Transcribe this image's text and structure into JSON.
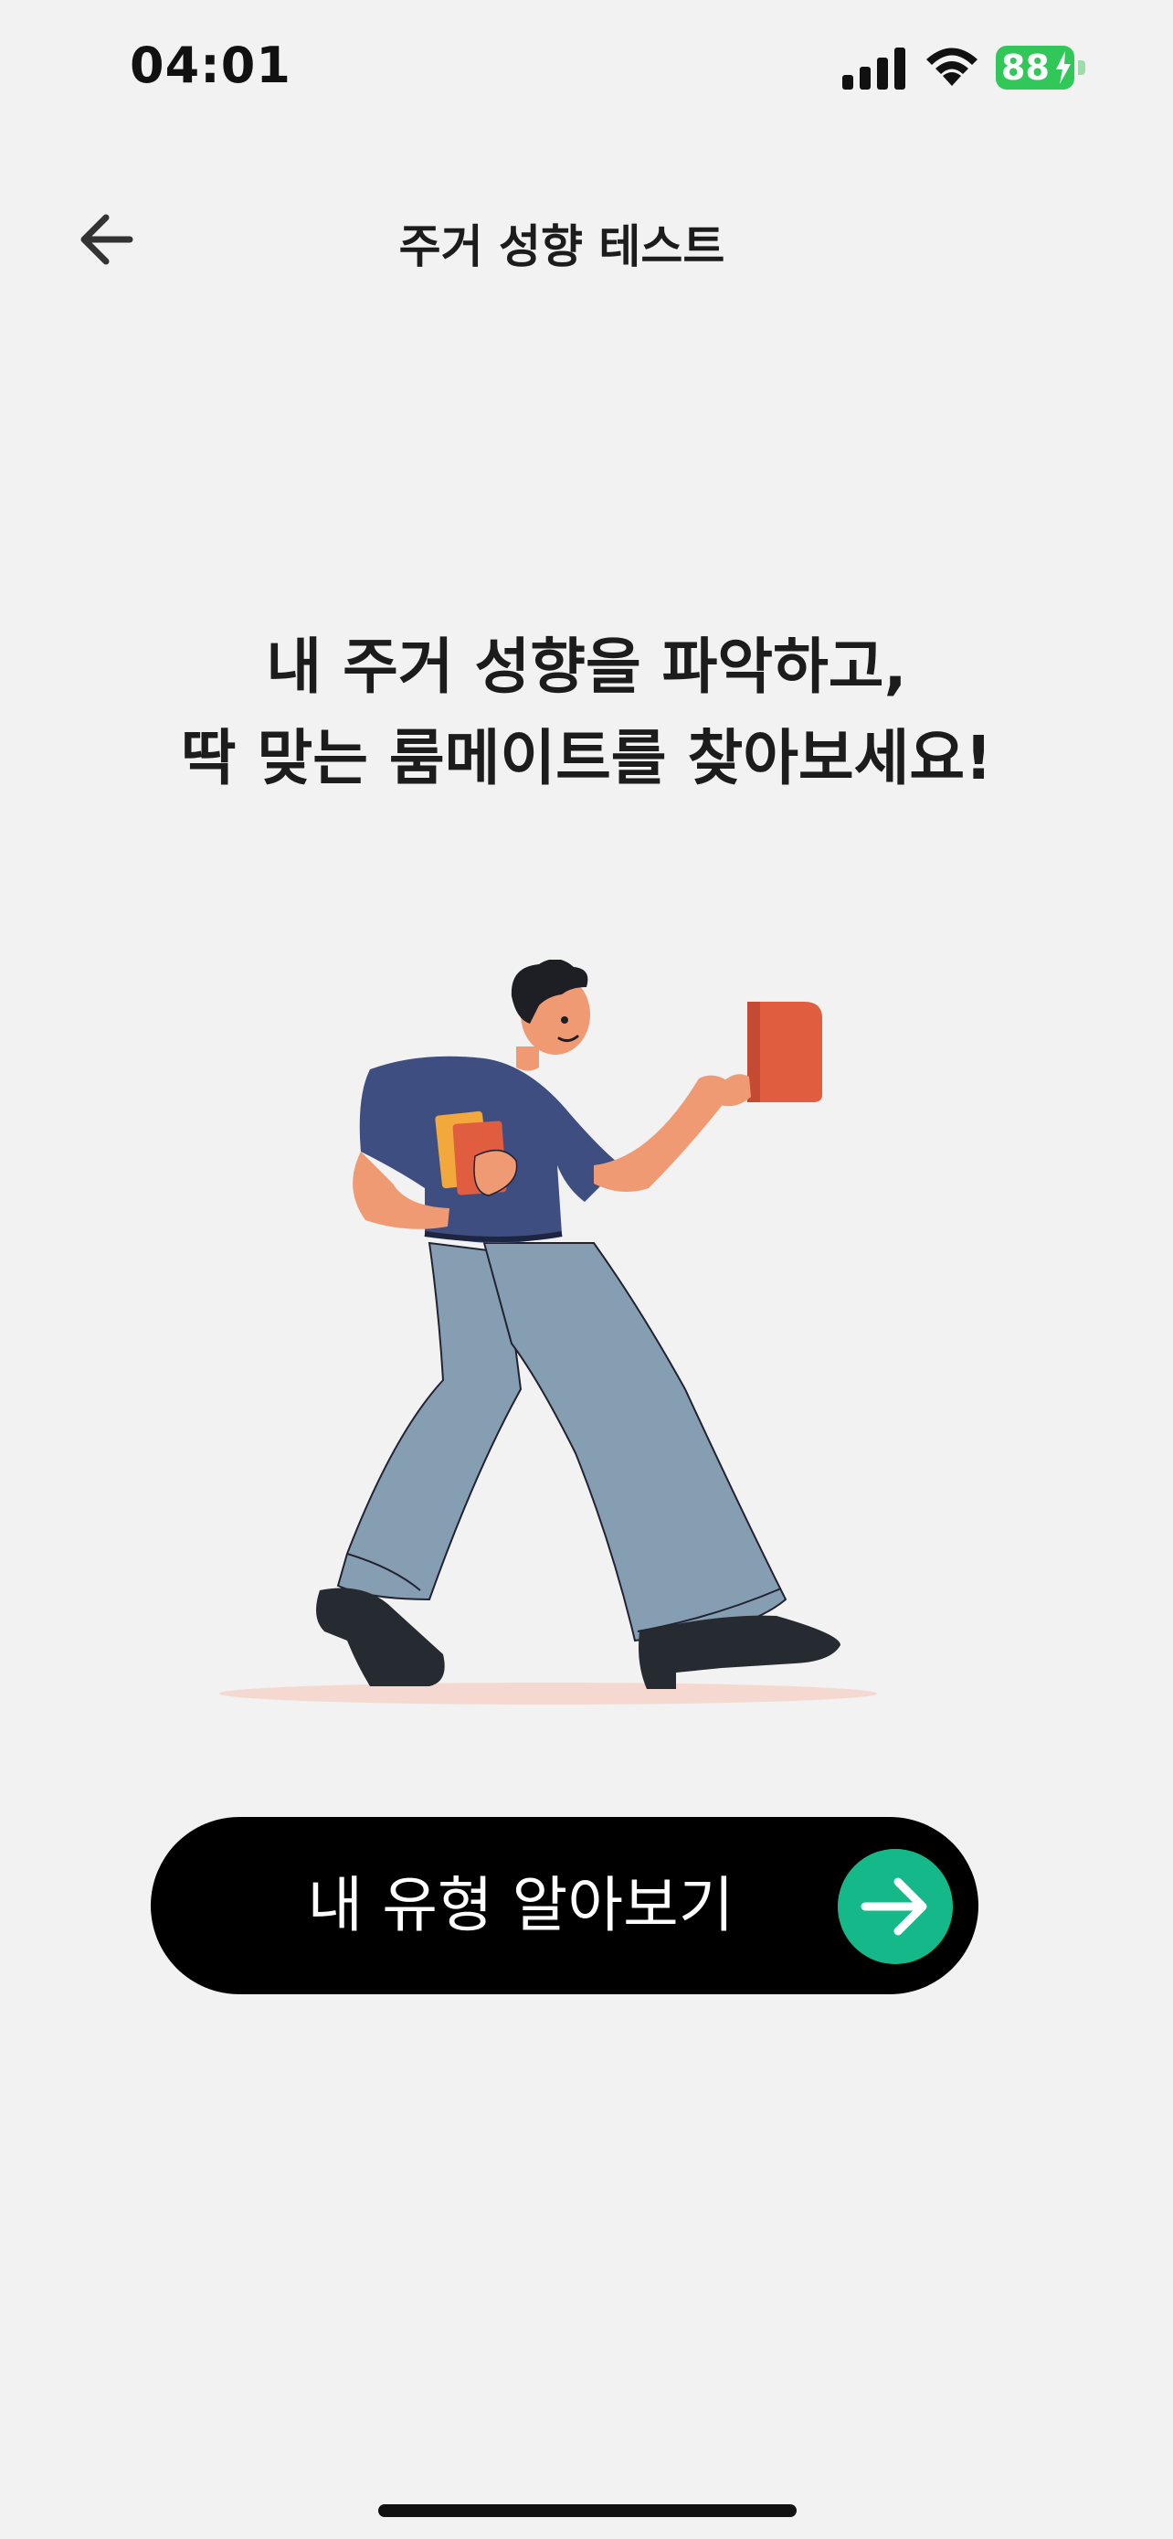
{
  "status_bar": {
    "time": "04:01",
    "battery_level": "88",
    "icons": [
      "signal-icon",
      "wifi-icon",
      "battery-charging-icon"
    ]
  },
  "header": {
    "title": "주거 성향 테스트",
    "back_icon": "back-arrow-icon"
  },
  "main": {
    "headline_line1": "내 주거 성향을 파악하고,",
    "headline_line2": "딱 맞는 룸메이트를 찾아보세요!",
    "illustration": "person-walking-with-books"
  },
  "cta": {
    "label": "내 유형 알아보기",
    "icon": "arrow-right-icon",
    "accent_color": "#14b889"
  },
  "colors": {
    "background": "#f2f2f2",
    "button": "#000000",
    "battery": "#32c759"
  }
}
